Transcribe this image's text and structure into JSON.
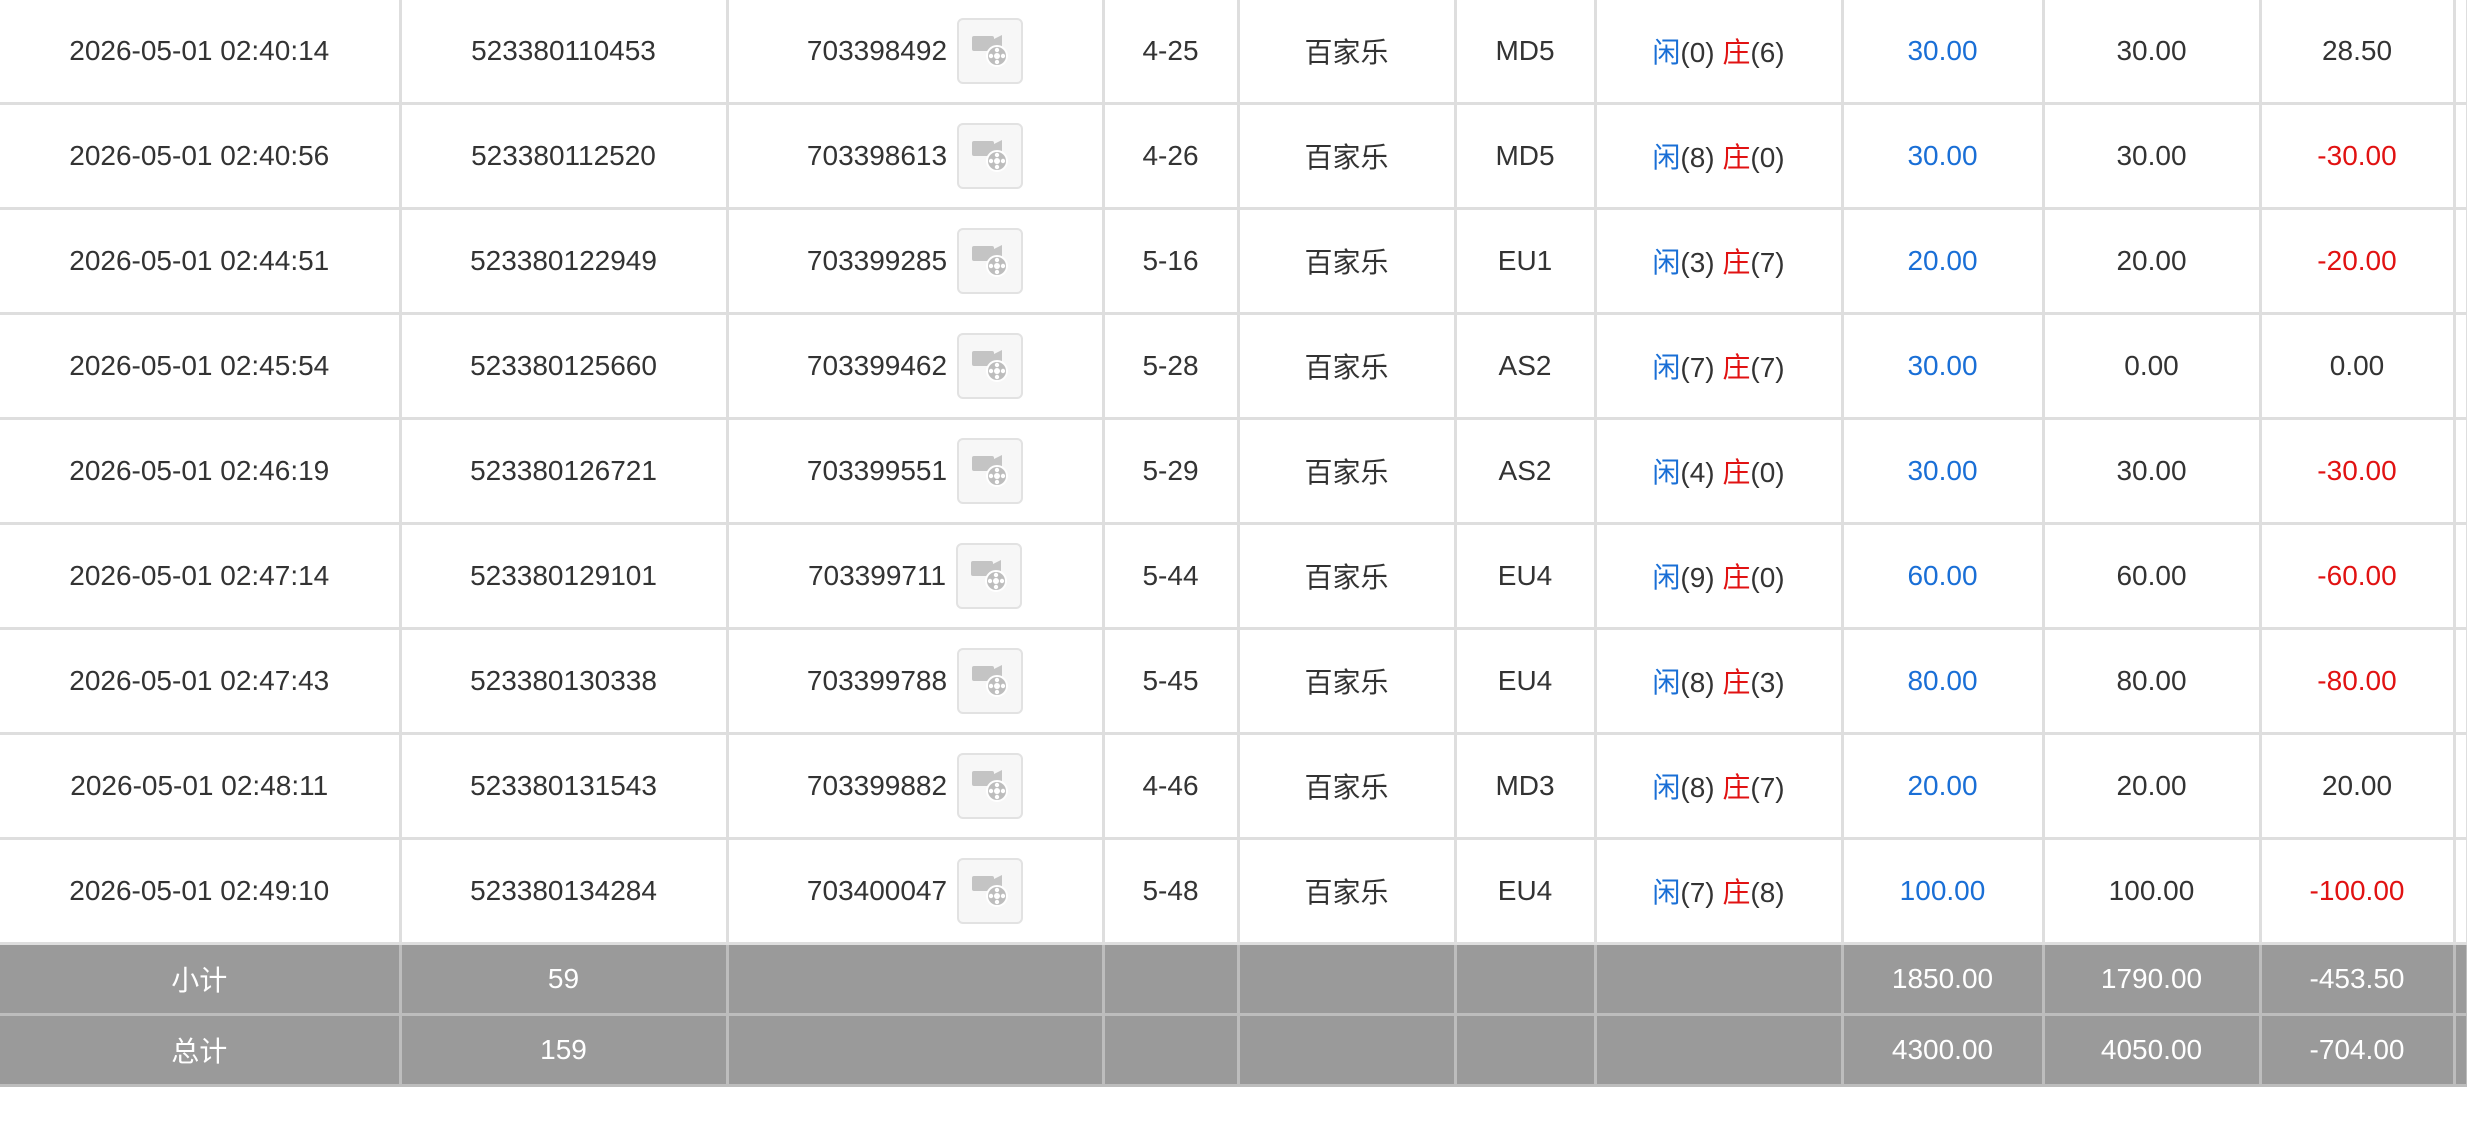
{
  "rows": [
    {
      "time": "2026-05-01 02:40:14",
      "bet_id": "523380110453",
      "round": "703398492",
      "table": "4-25",
      "game": "百家乐",
      "hall": "MD5",
      "player_label": "闲",
      "player": "(0)",
      "banker_label": "庄",
      "banker": "(6)",
      "bet": "30.00",
      "valid": "30.00",
      "result": "28.50",
      "result_neg": false
    },
    {
      "time": "2026-05-01 02:40:56",
      "bet_id": "523380112520",
      "round": "703398613",
      "table": "4-26",
      "game": "百家乐",
      "hall": "MD5",
      "player_label": "闲",
      "player": "(8)",
      "banker_label": "庄",
      "banker": "(0)",
      "bet": "30.00",
      "valid": "30.00",
      "result": "-30.00",
      "result_neg": true
    },
    {
      "time": "2026-05-01 02:44:51",
      "bet_id": "523380122949",
      "round": "703399285",
      "table": "5-16",
      "game": "百家乐",
      "hall": "EU1",
      "player_label": "闲",
      "player": "(3)",
      "banker_label": "庄",
      "banker": "(7)",
      "bet": "20.00",
      "valid": "20.00",
      "result": "-20.00",
      "result_neg": true
    },
    {
      "time": "2026-05-01 02:45:54",
      "bet_id": "523380125660",
      "round": "703399462",
      "table": "5-28",
      "game": "百家乐",
      "hall": "AS2",
      "player_label": "闲",
      "player": "(7)",
      "banker_label": "庄",
      "banker": "(7)",
      "bet": "30.00",
      "valid": "0.00",
      "result": "0.00",
      "result_neg": false
    },
    {
      "time": "2026-05-01 02:46:19",
      "bet_id": "523380126721",
      "round": "703399551",
      "table": "5-29",
      "game": "百家乐",
      "hall": "AS2",
      "player_label": "闲",
      "player": "(4)",
      "banker_label": "庄",
      "banker": "(0)",
      "bet": "30.00",
      "valid": "30.00",
      "result": "-30.00",
      "result_neg": true
    },
    {
      "time": "2026-05-01 02:47:14",
      "bet_id": "523380129101",
      "round": "703399711",
      "table": "5-44",
      "game": "百家乐",
      "hall": "EU4",
      "player_label": "闲",
      "player": "(9)",
      "banker_label": "庄",
      "banker": "(0)",
      "bet": "60.00",
      "valid": "60.00",
      "result": "-60.00",
      "result_neg": true
    },
    {
      "time": "2026-05-01 02:47:43",
      "bet_id": "523380130338",
      "round": "703399788",
      "table": "5-45",
      "game": "百家乐",
      "hall": "EU4",
      "player_label": "闲",
      "player": "(8)",
      "banker_label": "庄",
      "banker": "(3)",
      "bet": "80.00",
      "valid": "80.00",
      "result": "-80.00",
      "result_neg": true
    },
    {
      "time": "2026-05-01 02:48:11",
      "bet_id": "523380131543",
      "round": "703399882",
      "table": "4-46",
      "game": "百家乐",
      "hall": "MD3",
      "player_label": "闲",
      "player": "(8)",
      "banker_label": "庄",
      "banker": "(7)",
      "bet": "20.00",
      "valid": "20.00",
      "result": "20.00",
      "result_neg": false
    },
    {
      "time": "2026-05-01 02:49:10",
      "bet_id": "523380134284",
      "round": "703400047",
      "table": "5-48",
      "game": "百家乐",
      "hall": "EU4",
      "player_label": "闲",
      "player": "(7)",
      "banker_label": "庄",
      "banker": "(8)",
      "bet": "100.00",
      "valid": "100.00",
      "result": "-100.00",
      "result_neg": true
    }
  ],
  "subtotal": {
    "label": "小计",
    "count": "59",
    "bet": "1850.00",
    "valid": "1790.00",
    "result": "-453.50"
  },
  "total": {
    "label": "总计",
    "count": "159",
    "bet": "4300.00",
    "valid": "4050.00",
    "result": "-704.00"
  },
  "icons": {
    "video": "video-replay-icon"
  },
  "colors": {
    "blue": "#1a6fd6",
    "red": "#e11212",
    "summary_bg": "#9a9a9a"
  }
}
